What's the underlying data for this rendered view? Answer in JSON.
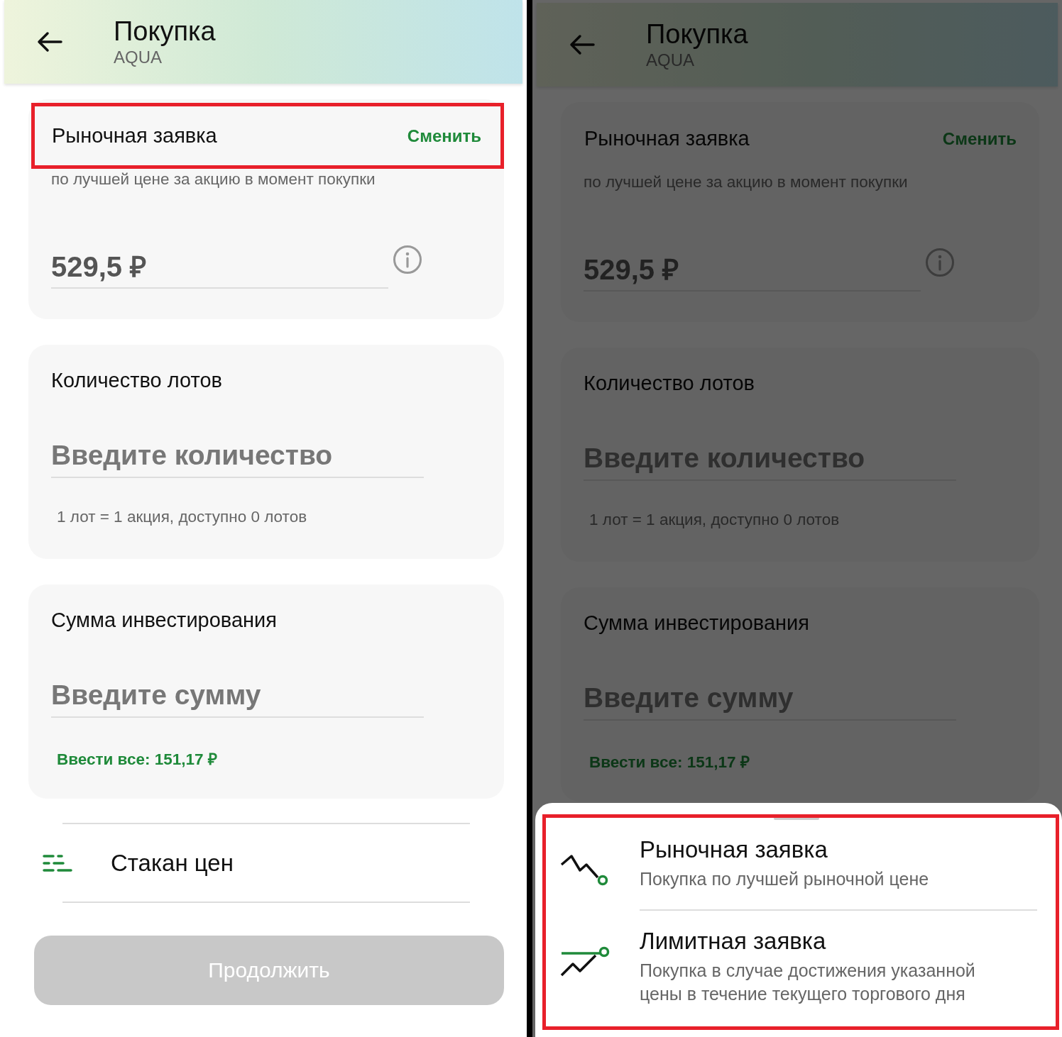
{
  "screens": [
    {
      "dimmed": false,
      "header": {
        "title": "Покупка",
        "subtitle": "AQUA"
      },
      "order_type": {
        "label": "Рыночная заявка",
        "action": "Сменить",
        "highlighted": true,
        "description": "по лучшей цене за акцию в момент покупки",
        "price": "529,5 ₽"
      },
      "lots": {
        "label": "Количество лотов",
        "placeholder": "Введите количество",
        "hint": "1 лот = 1 акция, доступно 0 лотов"
      },
      "amount": {
        "label": "Сумма инвестирования",
        "placeholder": "Введите сумму",
        "fill_all": "Ввести все: 151,17 ₽"
      },
      "order_book": {
        "label": "Стакан цен"
      },
      "button": {
        "label": "Продолжить",
        "disabled": true
      }
    },
    {
      "dimmed": true,
      "header": {
        "title": "Покупка",
        "subtitle": "AQUA"
      },
      "order_type": {
        "label": "Рыночная заявка",
        "action": "Сменить",
        "highlighted": false,
        "description": "по лучшей цене за акцию в момент покупки",
        "price": "529,5 ₽"
      },
      "lots": {
        "label": "Количество лотов",
        "placeholder": "Введите количество",
        "hint": "1 лот = 1 акция, доступно 0 лотов"
      },
      "amount": {
        "label": "Сумма инвестирования",
        "placeholder": "Введите сумму",
        "fill_all": "Ввести все: 151,17 ₽"
      },
      "sheet": {
        "highlighted": true,
        "options": [
          {
            "kind": "market",
            "title": "Рыночная заявка",
            "description": "Покупка по лучшей рыночной цене"
          },
          {
            "kind": "limit",
            "title": "Лимитная заявка",
            "description": "Покупка в случае достижения указанной цены в течение текущего торгового дня"
          }
        ]
      }
    }
  ]
}
